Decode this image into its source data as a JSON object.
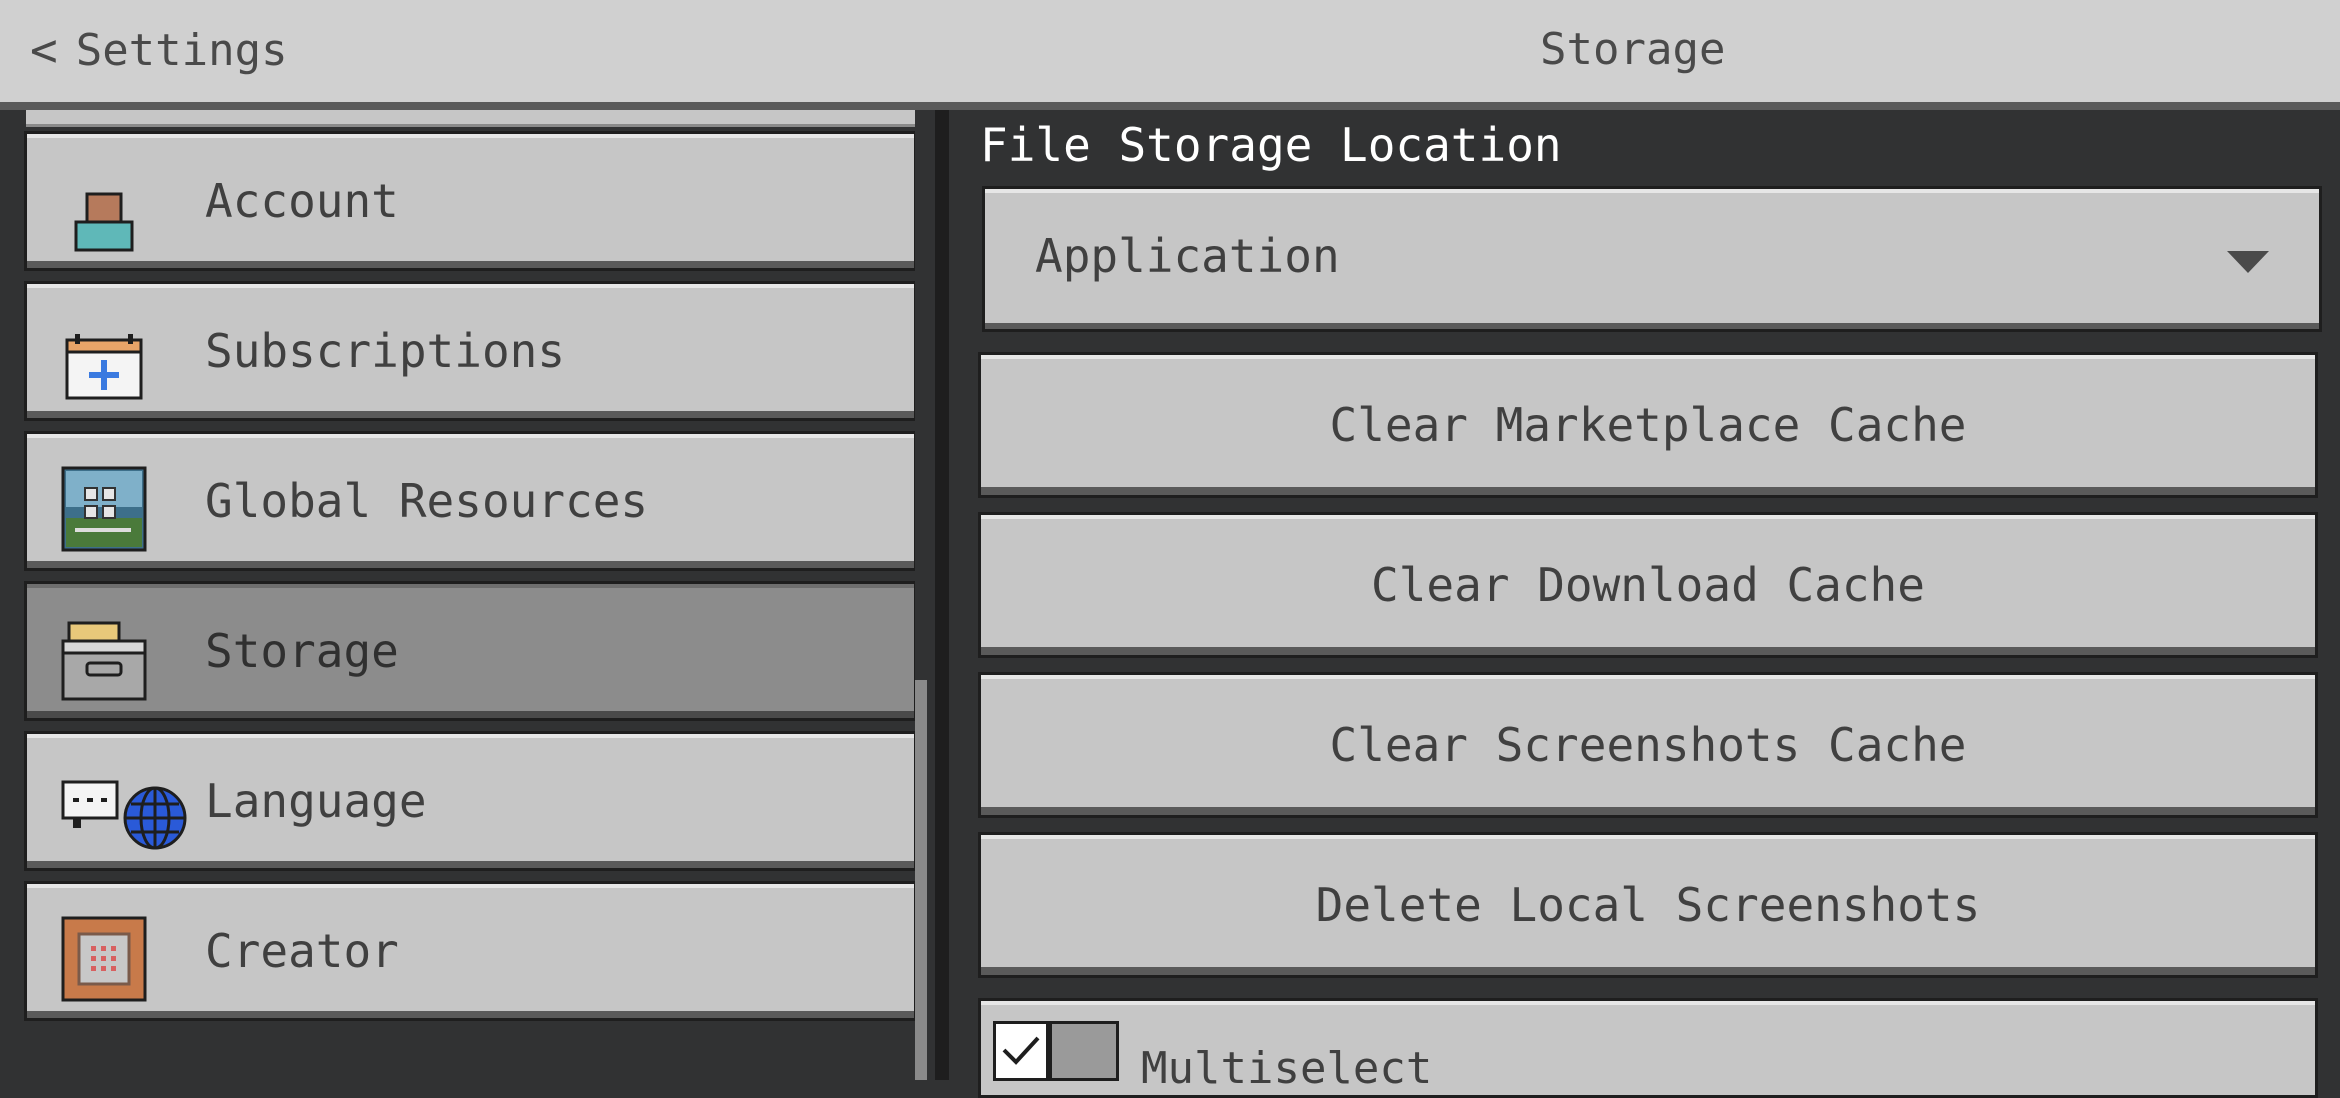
{
  "header": {
    "back_label": "Settings",
    "title": "Storage"
  },
  "sidebar": {
    "items": [
      {
        "label": "Account",
        "icon": "account-icon"
      },
      {
        "label": "Subscriptions",
        "icon": "calendar-plus-icon"
      },
      {
        "label": "Global Resources",
        "icon": "resource-pack-icon"
      },
      {
        "label": "Storage",
        "icon": "storage-drawer-icon",
        "selected": true
      },
      {
        "label": "Language",
        "icon": "chat-globe-icon"
      },
      {
        "label": "Creator",
        "icon": "command-block-icon"
      }
    ]
  },
  "main": {
    "file_storage_label": "File Storage Location",
    "file_storage_value": "Application",
    "buttons": [
      "Clear Marketplace Cache",
      "Clear Download Cache",
      "Clear Screenshots Cache",
      "Delete Local Screenshots"
    ],
    "multiselect_label": "Multiselect"
  },
  "colors": {
    "background": "#313233",
    "button": "#c6c6c6",
    "selected": "#8c8c8c",
    "header": "#d0d0d0"
  }
}
